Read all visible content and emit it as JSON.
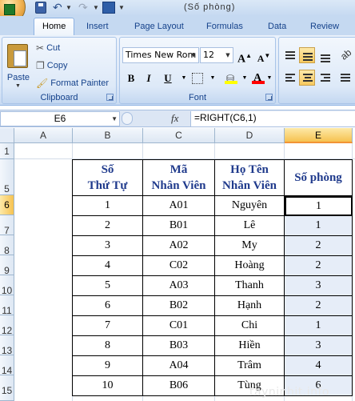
{
  "qat": {
    "title": "(Số phòng)"
  },
  "tabs": [
    "Home",
    "Insert",
    "Page Layout",
    "Formulas",
    "Data",
    "Review"
  ],
  "clipboard": {
    "paste_label": "Paste",
    "cut_label": "Cut",
    "copy_label": "Copy",
    "format_painter_label": "Format Painter",
    "group_label": "Clipboard"
  },
  "font": {
    "font_name": "Times New Rom",
    "font_size": "12",
    "grow_label": "A",
    "shrink_label": "A",
    "bold": "B",
    "italic": "I",
    "underline": "U",
    "color_letter": "A",
    "group_label": "Font",
    "fill_color": "#ffff00",
    "font_color": "#ff0000"
  },
  "formula_bar": {
    "name_box": "E6",
    "fx": "fx",
    "formula": "=RIGHT(C6,1)"
  },
  "columns": [
    "A",
    "B",
    "C",
    "D",
    "E"
  ],
  "rows": [
    "1",
    "5",
    "6",
    "7",
    "8",
    "9",
    "10",
    "11",
    "12",
    "13",
    "14",
    "15"
  ],
  "table": {
    "headers": [
      [
        "Số",
        "Thứ Tự"
      ],
      [
        "Mã",
        "Nhân Viên"
      ],
      [
        "Họ Tên",
        "Nhân Viên"
      ],
      [
        "Số phòng"
      ]
    ],
    "rows": [
      [
        "1",
        "A01",
        "Nguyên",
        "1"
      ],
      [
        "2",
        "B01",
        "Lê",
        "1"
      ],
      [
        "3",
        "A02",
        "My",
        "2"
      ],
      [
        "4",
        "C02",
        "Hoàng",
        "2"
      ],
      [
        "5",
        "A03",
        "Thanh",
        "3"
      ],
      [
        "6",
        "B02",
        "Hạnh",
        "2"
      ],
      [
        "7",
        "C01",
        "Chi",
        "1"
      ],
      [
        "8",
        "B03",
        "Hiền",
        "3"
      ],
      [
        "9",
        "A04",
        "Trâm",
        "4"
      ],
      [
        "10",
        "B06",
        "Tùng",
        "6"
      ]
    ]
  },
  "watermark": "tayninhit.info"
}
